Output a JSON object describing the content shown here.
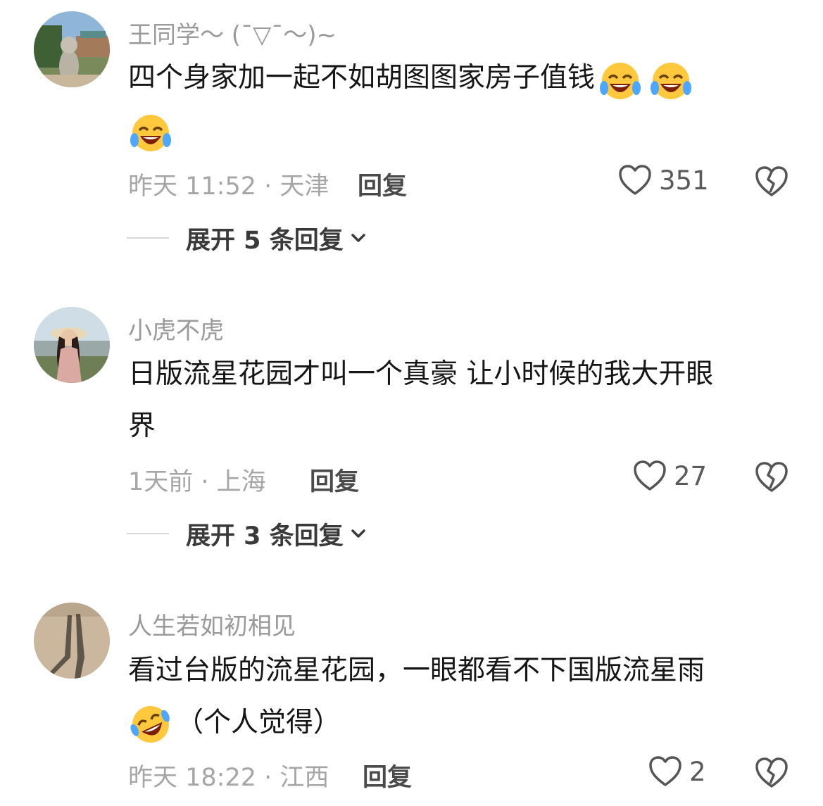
{
  "comments": [
    {
      "username": "王同学～ (¯▽¯～)~",
      "text_line1": "四个身家加一起不如胡图图家房子值钱",
      "emoji_after": "laugh-cry-emoji",
      "time_location": "昨天 11:52 · 天津",
      "reply_label": "回复",
      "likes": "351",
      "expand_label": "展开 5 条回复"
    },
    {
      "username": "小虎不虎",
      "text_line1": "日版流星花园才叫一个真豪 让小时候的我大开眼",
      "text_line2": "界",
      "time_location": "1天前 · 上海",
      "reply_label": "回复",
      "likes": "27",
      "expand_label": "展开 3 条回复"
    },
    {
      "username": "人生若如初相见",
      "text_line1": "看过台版的流星花园，一眼都看不下国版流星雨",
      "text_line2": "（个人觉得）",
      "time_location": "昨天 18:22 · 江西",
      "reply_label": "回复",
      "likes": "2"
    }
  ],
  "icons": {
    "like": "heart-outline-icon",
    "dislike": "broken-heart-outline-icon",
    "expand": "chevron-down-icon"
  },
  "colors": {
    "username": "#9a9a9a",
    "meta": "#a6a6a6",
    "text": "#161616"
  }
}
